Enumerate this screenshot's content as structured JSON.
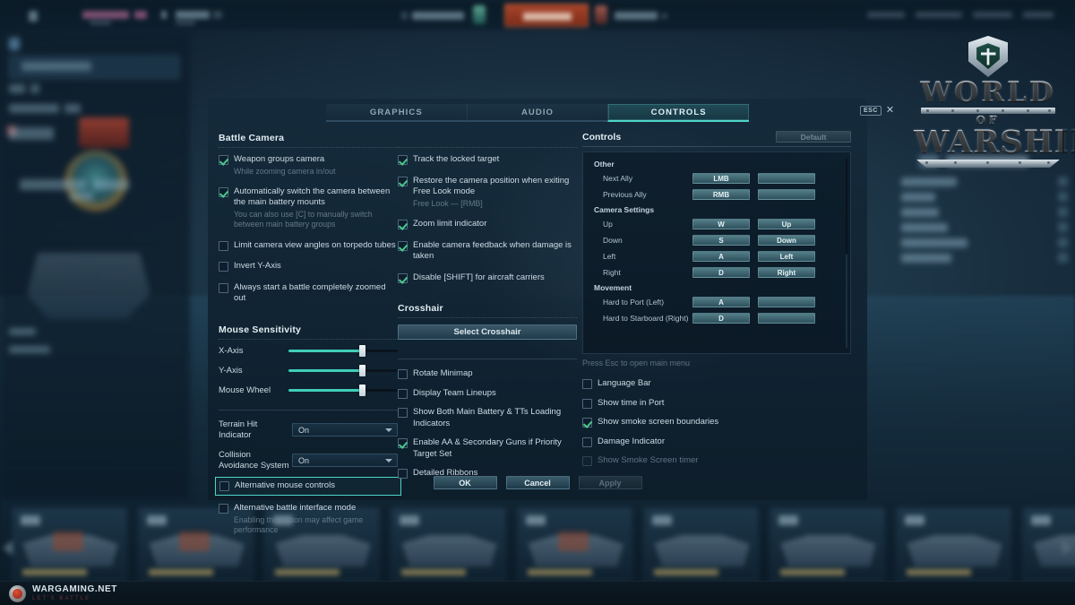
{
  "game": {
    "logo_line1": "WORLD",
    "logo_line2": "OF",
    "logo_line3": "WARSHIPS"
  },
  "footer": {
    "brand": "WARGAMING.NET",
    "tagline": "LET'S BATTLE"
  },
  "modal": {
    "tabs": [
      {
        "label": "GRAPHICS",
        "active": false
      },
      {
        "label": "AUDIO",
        "active": false
      },
      {
        "label": "CONTROLS",
        "active": true
      }
    ],
    "esc_badge": "ESC",
    "close_icon": "close-icon",
    "buttons": {
      "ok": "OK",
      "cancel": "Cancel",
      "apply": "Apply"
    }
  },
  "battle_camera": {
    "title": "Battle Camera",
    "left_items": [
      {
        "label": "Weapon groups camera",
        "sub": "While zooming camera in/out",
        "checked": true
      },
      {
        "label": "Automatically switch the camera between the main battery mounts",
        "sub": "You can also use [C] to manually switch between main battery groups",
        "checked": true
      },
      {
        "label": "Limit camera view angles on torpedo tubes",
        "sub": "",
        "checked": false
      },
      {
        "label": "Invert Y-Axis",
        "sub": "",
        "checked": false
      },
      {
        "label": "Always start a battle completely zoomed out",
        "sub": "",
        "checked": false
      }
    ],
    "right_items": [
      {
        "label": "Track the locked target",
        "sub": "",
        "checked": true
      },
      {
        "label": "Restore the camera position when exiting Free Look mode",
        "sub": "Free Look — [RMB]",
        "checked": true
      },
      {
        "label": "Zoom limit indicator",
        "sub": "",
        "checked": true
      },
      {
        "label": "Enable camera feedback when damage is taken",
        "sub": "",
        "checked": true
      },
      {
        "label": "Disable [SHIFT] for aircraft carriers",
        "sub": "",
        "checked": true
      }
    ]
  },
  "mouse_sensitivity": {
    "title": "Mouse Sensitivity",
    "sliders": [
      {
        "label": "X-Axis",
        "value": 67
      },
      {
        "label": "Y-Axis",
        "value": 67
      },
      {
        "label": "Mouse Wheel",
        "value": 67
      }
    ],
    "dropdowns": [
      {
        "label": "Terrain Hit Indicator",
        "value": "On"
      },
      {
        "label": "Collision Avoidance System",
        "value": "On"
      }
    ],
    "extra_items": [
      {
        "label": "Alternative mouse controls",
        "sub": "",
        "checked": false,
        "highlighted": true
      },
      {
        "label": "Alternative battle interface mode",
        "sub": "Enabling this option may affect game performance",
        "checked": false,
        "highlighted": false
      }
    ]
  },
  "crosshair": {
    "title": "Crosshair",
    "select_button": "Select Crosshair",
    "items": [
      {
        "label": "Rotate Minimap",
        "checked": false
      },
      {
        "label": "Display Team Lineups",
        "checked": false
      },
      {
        "label": "Show Both Main Battery & TTs Loading Indicators",
        "checked": false
      },
      {
        "label": "Enable AA & Secondary Guns if Priority Target Set",
        "checked": true
      },
      {
        "label": "Detailed Ribbons",
        "checked": false
      }
    ]
  },
  "interface_options": [
    {
      "label": "Language Bar",
      "checked": false,
      "disabled": false
    },
    {
      "label": "Show time in Port",
      "checked": false,
      "disabled": false
    },
    {
      "label": "Show smoke screen boundaries",
      "checked": true,
      "disabled": false
    },
    {
      "label": "Damage Indicator",
      "checked": false,
      "disabled": false
    },
    {
      "label": "Show Smoke Screen timer",
      "checked": false,
      "disabled": true
    }
  ],
  "controls_panel": {
    "title": "Controls",
    "default_button": "Default",
    "esc_hint": "Press Esc to open main menu",
    "groups": [
      {
        "name": "Other",
        "bindings": [
          {
            "action": "Next Ally",
            "key1": "LMB",
            "key2": ""
          },
          {
            "action": "Previous Ally",
            "key1": "RMB",
            "key2": ""
          }
        ]
      },
      {
        "name": "Camera Settings",
        "bindings": [
          {
            "action": "Up",
            "key1": "W",
            "key2": "Up"
          },
          {
            "action": "Down",
            "key1": "S",
            "key2": "Down"
          },
          {
            "action": "Left",
            "key1": "A",
            "key2": "Left"
          },
          {
            "action": "Right",
            "key1": "D",
            "key2": "Right"
          }
        ]
      },
      {
        "name": "Movement",
        "bindings": [
          {
            "action": "Hard to Port (Left)",
            "key1": "A",
            "key2": ""
          },
          {
            "action": "Hard to Starboard (Right)",
            "key1": "D",
            "key2": ""
          }
        ]
      }
    ]
  },
  "colors": {
    "accent": "#4fd6c8",
    "check": "#49c98e",
    "panel": "#142a3a",
    "text": "#ccdbe4",
    "muted": "#62798a"
  }
}
